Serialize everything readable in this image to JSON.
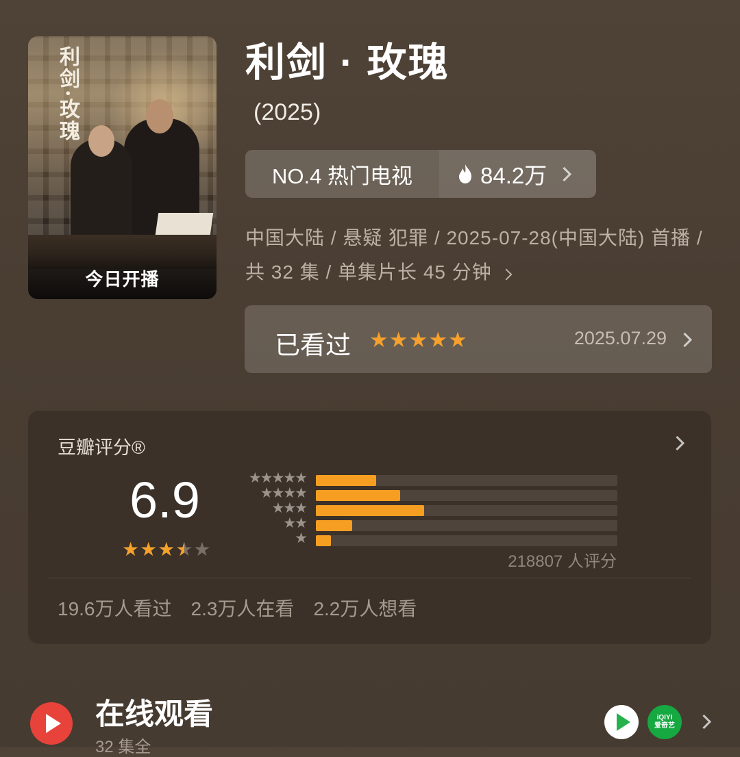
{
  "poster": {
    "title_art": "利剑·玫瑰",
    "badge": "今日开播"
  },
  "title": "利剑 · 玫瑰",
  "year": "(2025)",
  "rank": {
    "label": "NO.4 热门电视",
    "heat_icon": "flame-icon",
    "heat": "84.2万"
  },
  "meta": "中国大陆 / 悬疑 犯罪 / 2025-07-28(中国大陆) 首播 / 共 32 集 / 单集片长 45 分钟",
  "watched": {
    "label": "已看过",
    "stars": "★★★★★",
    "star_count": 5,
    "date": "2025.07.29"
  },
  "rating": {
    "header": "豆瓣评分®",
    "score": "6.9",
    "stars_filled": 3.5,
    "stars_on": "★★★",
    "stars_half": "★",
    "stars_off": "★",
    "distribution": [
      {
        "stars": "★★★★★",
        "level": 0.2
      },
      {
        "stars": "★★★★",
        "level": 0.28
      },
      {
        "stars": "★★★",
        "level": 0.36
      },
      {
        "stars": "★★",
        "level": 0.12
      },
      {
        "stars": "★",
        "level": 0.05
      }
    ],
    "votes": "218807 人评分",
    "watched": "19.6万人看过",
    "watching": "2.3万人在看",
    "wish": "2.2万人想看"
  },
  "online": {
    "title": "在线观看",
    "subtitle": "32 集全",
    "apps": [
      "tencent-video-icon",
      "iqiyi-icon"
    ],
    "iqiyi_line1": "iQIYI",
    "iqiyi_line2": "爱奇艺"
  },
  "colors": {
    "accent": "#f5a12b",
    "background": "#4d4035",
    "card": "#3b3129"
  }
}
